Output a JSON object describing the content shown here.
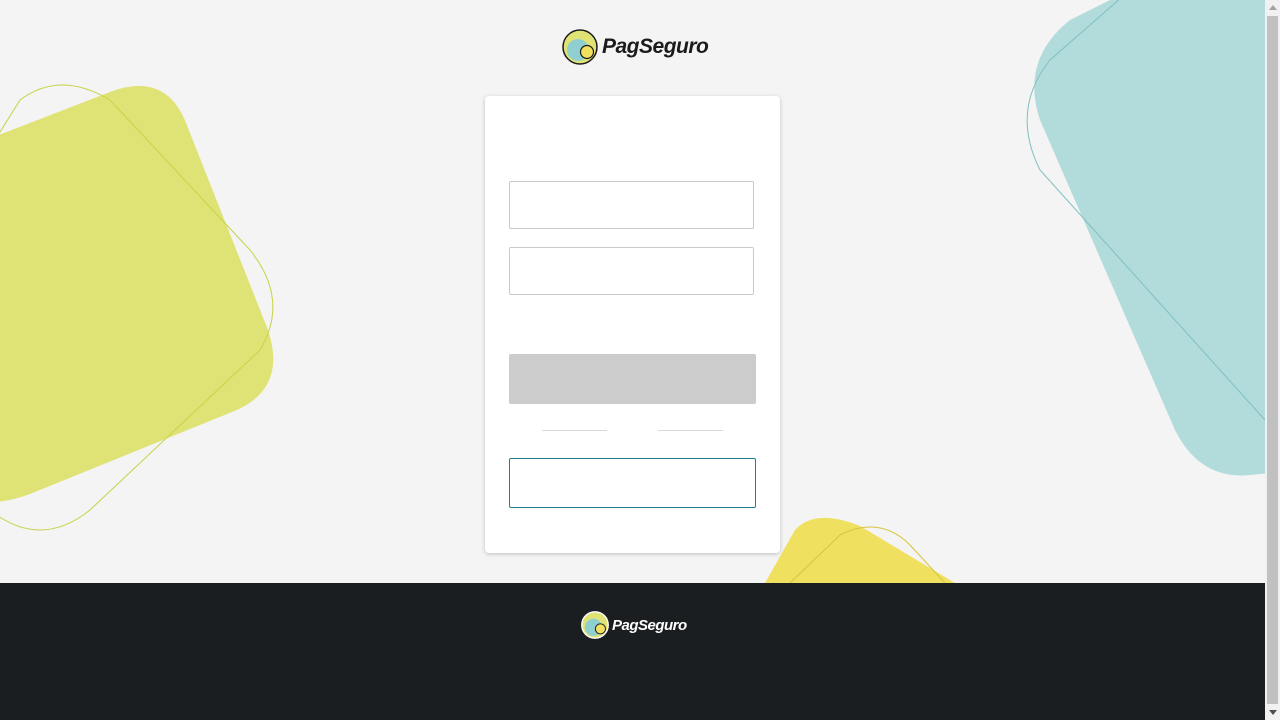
{
  "brand": {
    "name": "PagSeguro",
    "logo_icon": "pagseguro-logo-icon",
    "colors": {
      "lime": "#dfe375",
      "teal": "#b2dbdb",
      "yellow": "#f0e060",
      "footer_bg": "#1b1e21",
      "accent": "#1e7f8c"
    }
  },
  "login_form": {
    "email": {
      "value": "",
      "placeholder": ""
    },
    "password": {
      "value": "",
      "placeholder": ""
    },
    "submit_label": "",
    "secondary_label": ""
  },
  "footer": {
    "brand_name": "PagSeguro"
  }
}
